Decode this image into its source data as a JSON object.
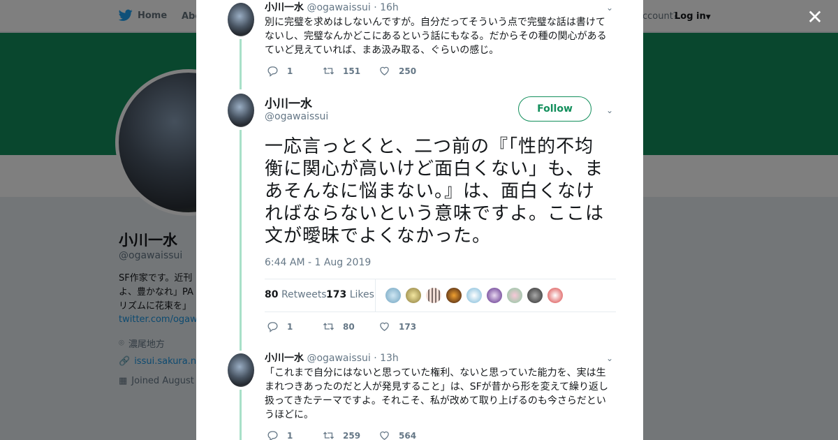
{
  "nav": {
    "home": "Home",
    "about": "Abo",
    "account": "account?",
    "login": "Log in"
  },
  "profile": {
    "name": "小川一水",
    "handle": "@ogawaissui",
    "bio": "SF作家です。近刊\nよ、豊かなれ」PA\nリズムに花束を」",
    "link": "twitter.com/ogawa",
    "location": "濃尾地方",
    "website": "issui.sakura.ne",
    "joined": "Joined August"
  },
  "tweets": {
    "prev": {
      "name": "小川一水",
      "handle": "@ogawaissui",
      "time": "· 16h",
      "text": "別に完璧を求めはしないんですが。自分だってそういう点で完璧な話は書けてないし、完璧なんかどこにあるという話にもなる。だからその種の関心があるていど見えていれば、まあ汲み取る、ぐらいの感じ。",
      "replies": "1",
      "retweets": "151",
      "likes": "250"
    },
    "main": {
      "name": "小川一水",
      "handle": "@ogawaissui",
      "follow": "Follow",
      "text": "一応言っとくと、二つ前の『「性的不均衡に関心が高いけど面白くない」も、まあそんなに悩まない。』は、面白くなければならないという意味ですよ。ここは文が曖昧でよくなかった。",
      "time": "6:44 AM - 1 Aug 2019",
      "retweet_count": "80",
      "retweet_label": "Retweets",
      "like_count": "173",
      "like_label": "Likes",
      "replies": "1",
      "retweets": "80",
      "likes": "173"
    },
    "next": {
      "name": "小川一水",
      "handle": "@ogawaissui",
      "time": "· 13h",
      "text": "「これまで自分にはないと思っていた権利、ないと思っていた能力を、実は生まれつきあったのだと人が発見すること」は、SFが昔から形を変えて繰り返し扱ってきたテーマですよ。それこそ、私が改めて取り上げるのも今さらだというほどに。",
      "replies": "1",
      "retweets": "259",
      "likes": "564"
    }
  },
  "colors": {
    "accent": "#138f5c",
    "link": "#1b95e0",
    "thread": "#a8e0c8"
  }
}
